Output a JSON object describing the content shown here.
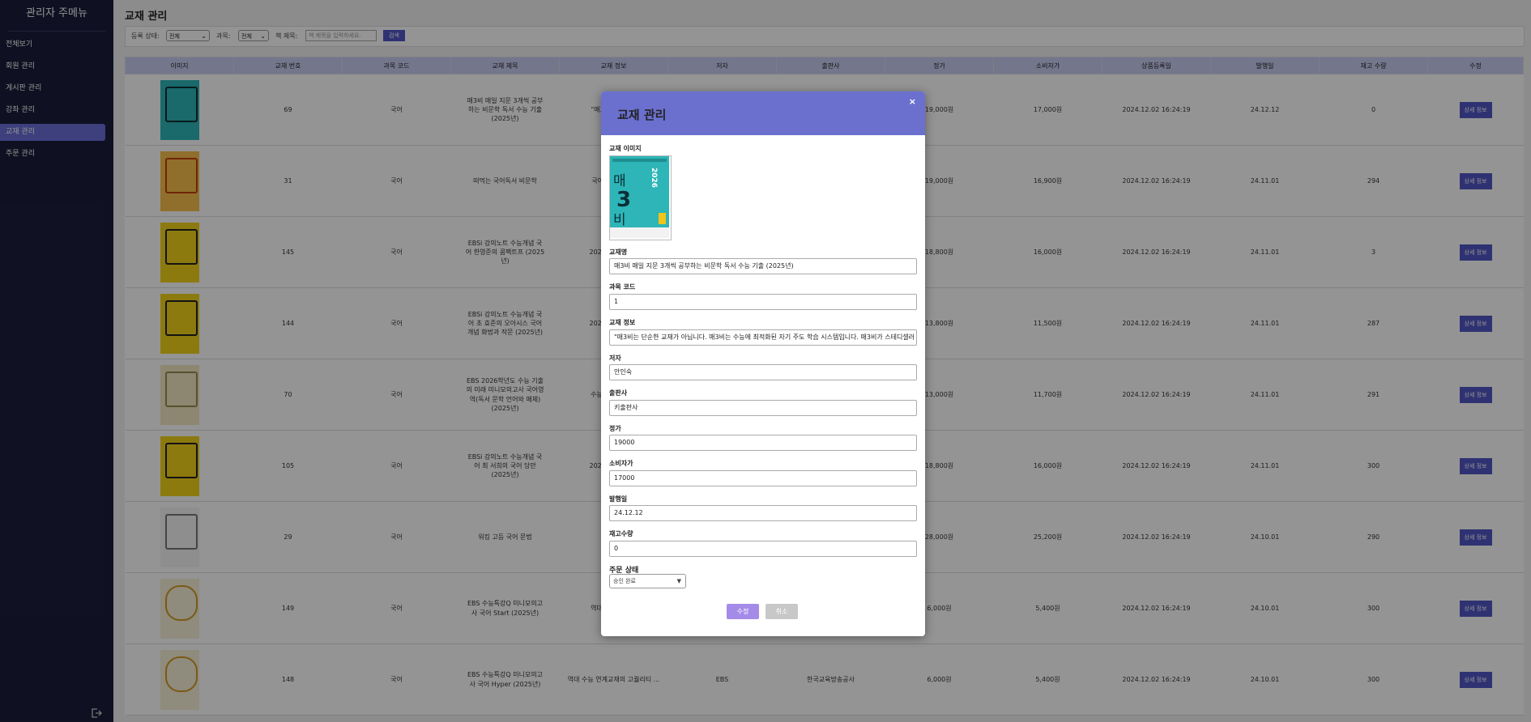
{
  "sidebar": {
    "title": "관리자 주메뉴",
    "items": [
      {
        "label": "전체보기",
        "active": false
      },
      {
        "label": "회원 관리",
        "active": false
      },
      {
        "label": "게시판 관리",
        "active": false
      },
      {
        "label": "강좌 관리",
        "active": false
      },
      {
        "label": "교재 관리",
        "active": true
      },
      {
        "label": "주문 관리",
        "active": false
      }
    ],
    "logout_icon": "logout-icon"
  },
  "page": {
    "title": "교재 관리"
  },
  "filter": {
    "status_label": "등록 상태:",
    "status_value": "전체",
    "subject_label": "과목:",
    "subject_value": "전체",
    "title_label": "책 제목:",
    "title_placeholder": "책 제목을 입력하세요.",
    "search_button": "검색"
  },
  "table": {
    "headers": [
      "이미지",
      "교재 번호",
      "과목 코드",
      "교재 제목",
      "교재 정보",
      "저자",
      "출판사",
      "정가",
      "소비자가",
      "상품등록일",
      "발행일",
      "재고 수량",
      "수정"
    ],
    "detail_button": "상세 정보",
    "rows": [
      {
        "cover": "teal",
        "no": "69",
        "subject": "국어",
        "title": "매3비 매일 지문 3개씩 공부하는 비문학 독서 수능 기출 (2025년)",
        "info": "\"매3비는 단순...",
        "author": "",
        "publisher": "",
        "price": "19,000원",
        "consumer": "17,000원",
        "regdate": "2024.12.02 16:24:19",
        "pubdate": "24.12.12",
        "stock": "0"
      },
      {
        "cover": "orange",
        "no": "31",
        "subject": "국어",
        "title": "떠먹는 국어독서 비문학",
        "info": "국어 노베이스...",
        "author": "",
        "publisher": "",
        "price": "19,000원",
        "consumer": "16,900원",
        "regdate": "2024.12.02 16:24:19",
        "pubdate": "24.11.01",
        "stock": "294"
      },
      {
        "cover": "yellow",
        "no": "145",
        "subject": "국어",
        "title": "EBSi 강의노트 수능개념 국어 한영준의 콤팩트프 (2025년)",
        "info": "2026학년도 수...",
        "author": "",
        "publisher": "",
        "price": "18,800원",
        "consumer": "16,000원",
        "regdate": "2024.12.02 16:24:19",
        "pubdate": "24.11.01",
        "stock": "3"
      },
      {
        "cover": "yellow",
        "no": "144",
        "subject": "국어",
        "title": "EBSi 강의노트 수능개념 국어 초 효준의 오아시스 국어개념 화법과 작문 (2025년)",
        "info": "2026학년도 수...",
        "author": "",
        "publisher": "",
        "price": "13,800원",
        "consumer": "11,500원",
        "regdate": "2024.12.02 16:24:19",
        "pubdate": "24.11.01",
        "stock": "287"
      },
      {
        "cover": "cream",
        "no": "70",
        "subject": "국어",
        "title": "EBS 2026학년도 수능 기출의 미래 미니모의고사 국어영역(독서 문학 언어와 매체) (2025년)",
        "info": "수능 실전 감각...",
        "author": "",
        "publisher": "",
        "price": "13,000원",
        "consumer": "11,700원",
        "regdate": "2024.12.02 16:24:19",
        "pubdate": "24.11.01",
        "stock": "291"
      },
      {
        "cover": "yellow",
        "no": "105",
        "subject": "국어",
        "title": "EBSi 강의노트 수능개념 국어 최 서희의 국어 당만 (2025년)",
        "info": "2026학년도 수...",
        "author": "",
        "publisher": "",
        "price": "18,800원",
        "consumer": "16,000원",
        "regdate": "2024.12.02 16:24:19",
        "pubdate": "24.11.01",
        "stock": "300"
      },
      {
        "cover": "white",
        "no": "29",
        "subject": "국어",
        "title": "워킹 고등 국어 문법",
        "info": "\"...",
        "author": "",
        "publisher": "",
        "price": "28,000원",
        "consumer": "25,200원",
        "regdate": "2024.12.02 16:24:19",
        "pubdate": "24.10.01",
        "stock": "290"
      },
      {
        "cover": "gold",
        "no": "149",
        "subject": "국어",
        "title": "EBS 수능특강Q 미니모의고사 국어 Start (2025년)",
        "info": "역대 수능 연계...",
        "author": "",
        "publisher": "",
        "price": "6,000원",
        "consumer": "5,400원",
        "regdate": "2024.12.02 16:24:19",
        "pubdate": "24.10.01",
        "stock": "300"
      },
      {
        "cover": "gold",
        "no": "148",
        "subject": "국어",
        "title": "EBS 수능특강Q 미니모의고사 국어 Hyper (2025년)",
        "info": "역대 수능 연계교재의 고퀄리티 ...",
        "author": "EBS",
        "publisher": "한국교육방송공사",
        "price": "6,000원",
        "consumer": "5,400원",
        "regdate": "2024.12.02 16:24:19",
        "pubdate": "24.10.01",
        "stock": "300"
      }
    ]
  },
  "modal": {
    "title": "교재 관리",
    "close": "×",
    "image_label": "교재 이미지",
    "cover": {
      "line1": "매",
      "line2": "3",
      "line3": "비",
      "year": "2026"
    },
    "name_label": "교재명",
    "name_value": "매3비 매일 지문 3개씩 공부하는 비문학 독서 수능 기출 (2025년)",
    "code_label": "과목 코드",
    "code_value": "1",
    "info_label": "교재 정보",
    "info_value": "\"매3비는 단순한 교재가 아닙니다. 매3비는 수능에 최적화된 자기 주도 학습 시스템입니다. 매3비가 스테디셀러",
    "author_label": "저자",
    "author_value": "안인숙",
    "publisher_label": "출판사",
    "publisher_value": "키출판사",
    "price_label": "정가",
    "price_value": "19000",
    "consumer_label": "소비자가",
    "consumer_value": "17000",
    "pubdate_label": "발행일",
    "pubdate_value": "24.12.12",
    "stock_label": "재고수량",
    "stock_value": "0",
    "status_label": "주문 상태",
    "status_value": "승인 완료",
    "submit_button": "수정",
    "cancel_button": "취소"
  },
  "colors": {
    "sidebar_bg": "#1b1d3a",
    "accent": "#6b70cf",
    "button": "#5157c4",
    "submit": "#a58be8",
    "cancel": "#c8c8c8"
  }
}
